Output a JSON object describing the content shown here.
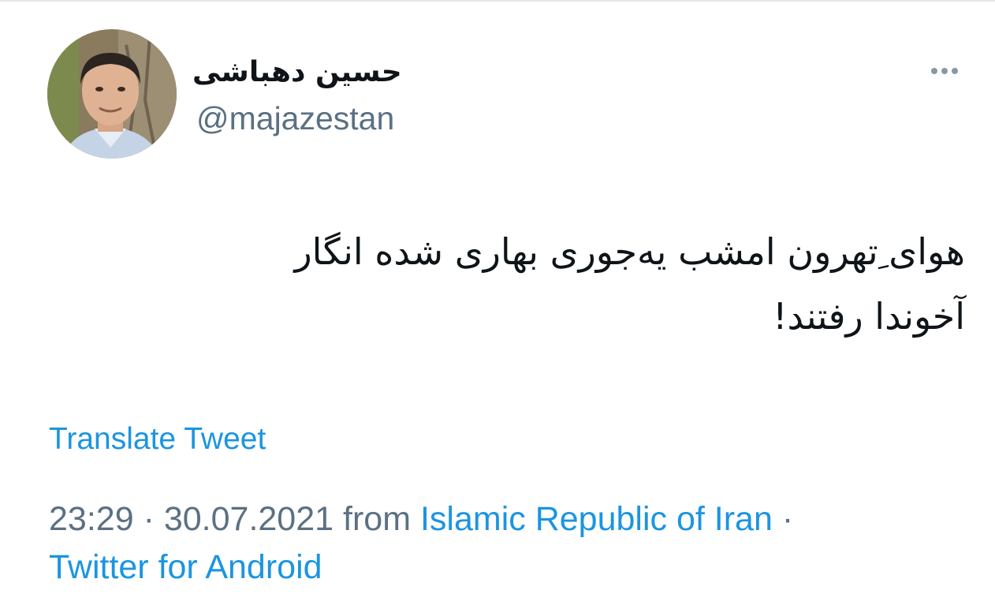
{
  "tweet": {
    "author": {
      "display_name": "حسین دهباشی",
      "handle": "@majazestan"
    },
    "more_icon": "more-horizontal-icon",
    "text": "هوای ِتهرون امشب یه‌جوری بهاری شده انگار\nآخوندا رفتند!",
    "translate_label": "Translate Tweet",
    "time": "23:29",
    "separator": "·",
    "date": "30.07.2021",
    "from_label": "from",
    "location": "Islamic Republic of Iran",
    "source": "Twitter for Android"
  },
  "colors": {
    "link": "#1b95e0",
    "muted": "#5b7083",
    "text": "#0f1419",
    "divider": "#e6e6e6"
  }
}
